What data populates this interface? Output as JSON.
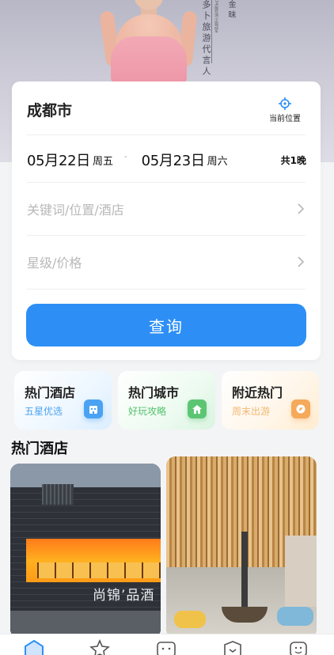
{
  "hero": {
    "vertical_text_main": "多卜旅游代言人",
    "vertical_text_small": "34届亚洲小姐冠军",
    "vertical_text_name": "金昧"
  },
  "search": {
    "city": "成都市",
    "locate_label": "当前位置",
    "checkin": {
      "date": "05月22日",
      "weekday": "周五"
    },
    "separator": "-",
    "checkout": {
      "date": "05月23日",
      "weekday": "周六"
    },
    "nights": "共1晚",
    "keyword_placeholder": "关键词/位置/酒店",
    "star_price_placeholder": "星级/价格",
    "query_button": "查询"
  },
  "categories": [
    {
      "title": "热门酒店",
      "subtitle": "五星优选",
      "icon": "hotel-icon",
      "color": "#4aa2f2"
    },
    {
      "title": "热门城市",
      "subtitle": "好玩攻略",
      "icon": "city-icon",
      "color": "#5cc574"
    },
    {
      "title": "附近热门",
      "subtitle": "周末出游",
      "icon": "compass-icon",
      "color": "#f5a95a"
    }
  ],
  "section": {
    "title": "热门酒店"
  },
  "hotels": [
    {
      "sign": "尚锦’品酒"
    },
    {
      "sign": ""
    }
  ],
  "tabbar": {
    "accent": "#2d8ff6",
    "icons": [
      "home-icon",
      "star-icon",
      "message-icon",
      "shield-icon",
      "profile-icon"
    ]
  }
}
